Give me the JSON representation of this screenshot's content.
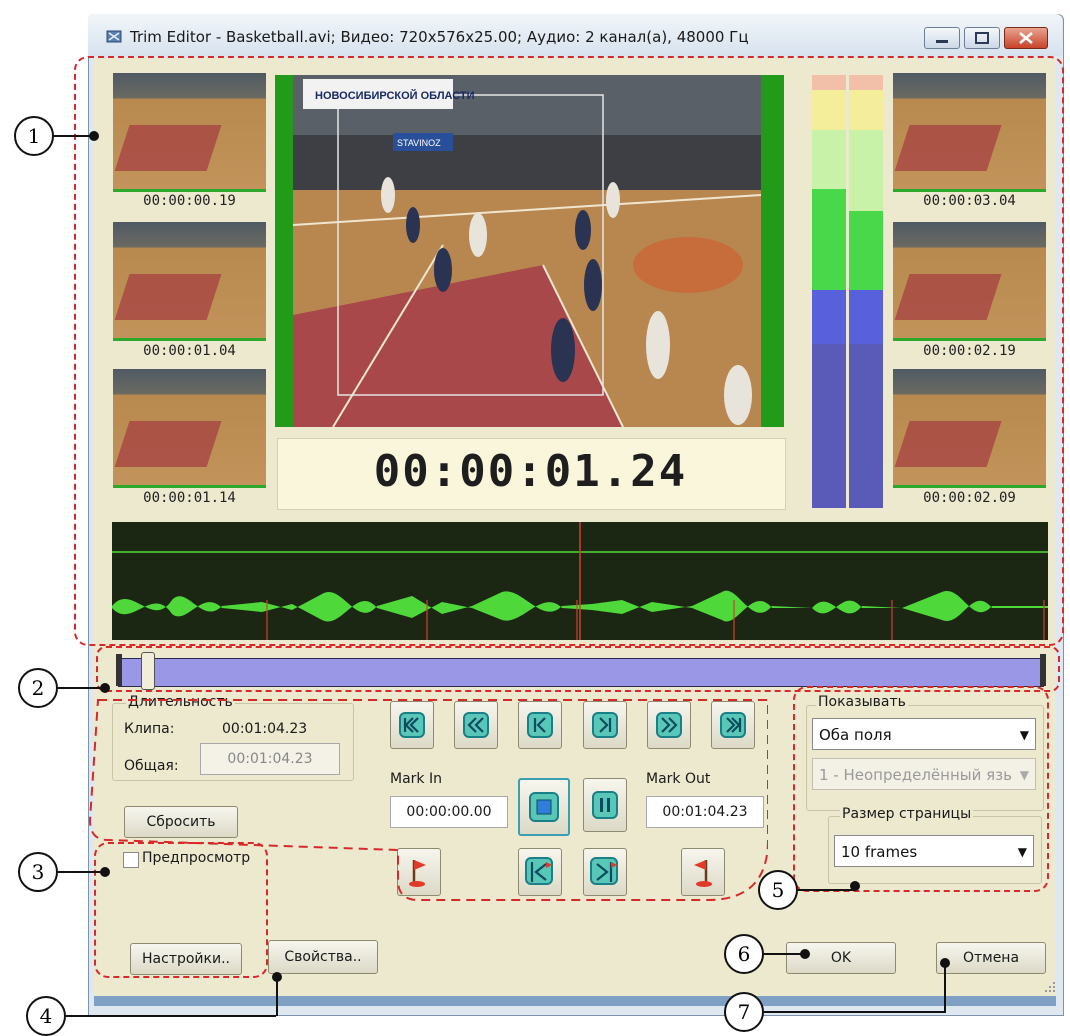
{
  "window": {
    "title": "Trim Editor - Basketball.avi; Видео: 720x576x25.00; Аудио: 2 канал(а), 48000 Гц"
  },
  "thumbnails_left": [
    "00:00:00.19",
    "00:00:01.04",
    "00:00:01.14"
  ],
  "thumbnails_right": [
    "00:00:03.04",
    "00:00:02.19",
    "00:00:02.09"
  ],
  "preview": {
    "timecode": "00:00:01.24",
    "banner": "НОВОСИБИРСКОЙ ОБЛАСТИ",
    "ad_board": "STAVINOZ"
  },
  "duration": {
    "group_label": "Длительность",
    "clip_label": "Клипа:",
    "clip_value": "00:01:04.23",
    "total_label": "Общая:",
    "total_value": "00:01:04.23",
    "reset_button": "Сбросить"
  },
  "marks": {
    "mark_in_label": "Mark In",
    "mark_in_value": "00:00:00.00",
    "mark_out_label": "Mark Out",
    "mark_out_value": "00:01:04.23"
  },
  "preview_option": {
    "checkbox_label": "Предпросмотр",
    "settings_button": "Настройки..",
    "properties_button": "Свойства.."
  },
  "display": {
    "group_label": "Показывать",
    "fields_value": "Оба поля",
    "language_value": "1 - Неопределённый язь",
    "page_size_label": "Размер страницы",
    "page_size_value": "10 frames"
  },
  "dialog": {
    "ok_button": "OK",
    "cancel_button": "Отмена"
  },
  "callouts": [
    "1",
    "2",
    "3",
    "4",
    "5",
    "6",
    "7"
  ],
  "colors": {
    "client_bg": "#ede9cf",
    "video_border": "#229a1a",
    "timeline": "#9a98e6",
    "waveform": "#4fd83a",
    "marker": "#d0402a",
    "callout_dash": "#d62a2a"
  }
}
